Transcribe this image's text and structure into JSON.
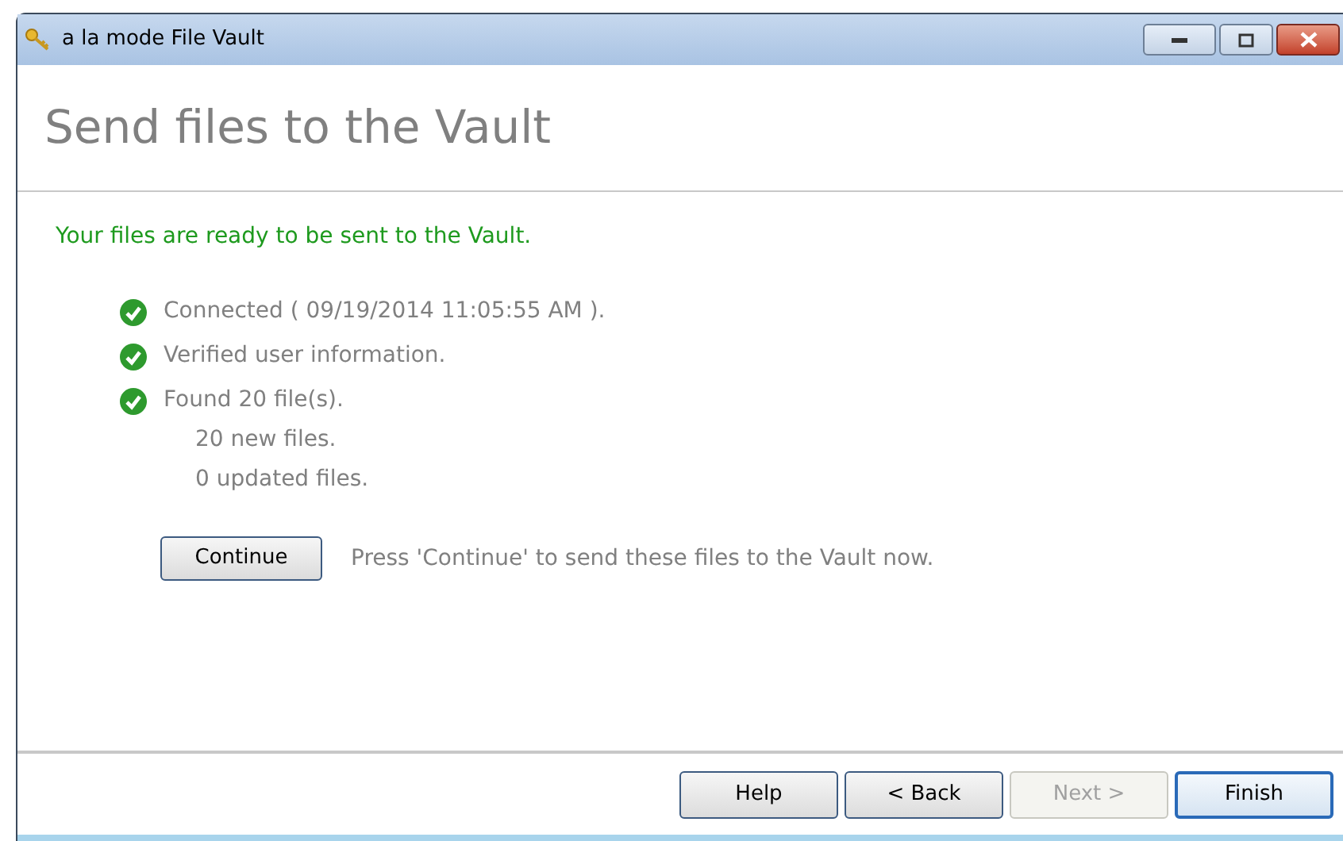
{
  "window": {
    "title": "a la mode File Vault"
  },
  "header": {
    "title": "Send files to the Vault"
  },
  "status_message": "Your files are ready to be sent to the Vault.",
  "steps": [
    {
      "text": "Connected ( 09/19/2014 11:05:55 AM ).",
      "done": true
    },
    {
      "text": "Verified user information.",
      "done": true
    },
    {
      "text": "Found 20 file(s).",
      "done": true,
      "details": [
        "20 new files.",
        "0 updated files."
      ]
    }
  ],
  "continue": {
    "label": "Continue",
    "hint": "Press 'Continue' to send these files to the Vault now."
  },
  "buttons": [
    {
      "label": "Help",
      "disabled": false,
      "default": false
    },
    {
      "label": "< Back",
      "disabled": false,
      "default": false
    },
    {
      "label": "Next >",
      "disabled": true,
      "default": false
    },
    {
      "label": "Finish",
      "disabled": false,
      "default": true
    }
  ]
}
